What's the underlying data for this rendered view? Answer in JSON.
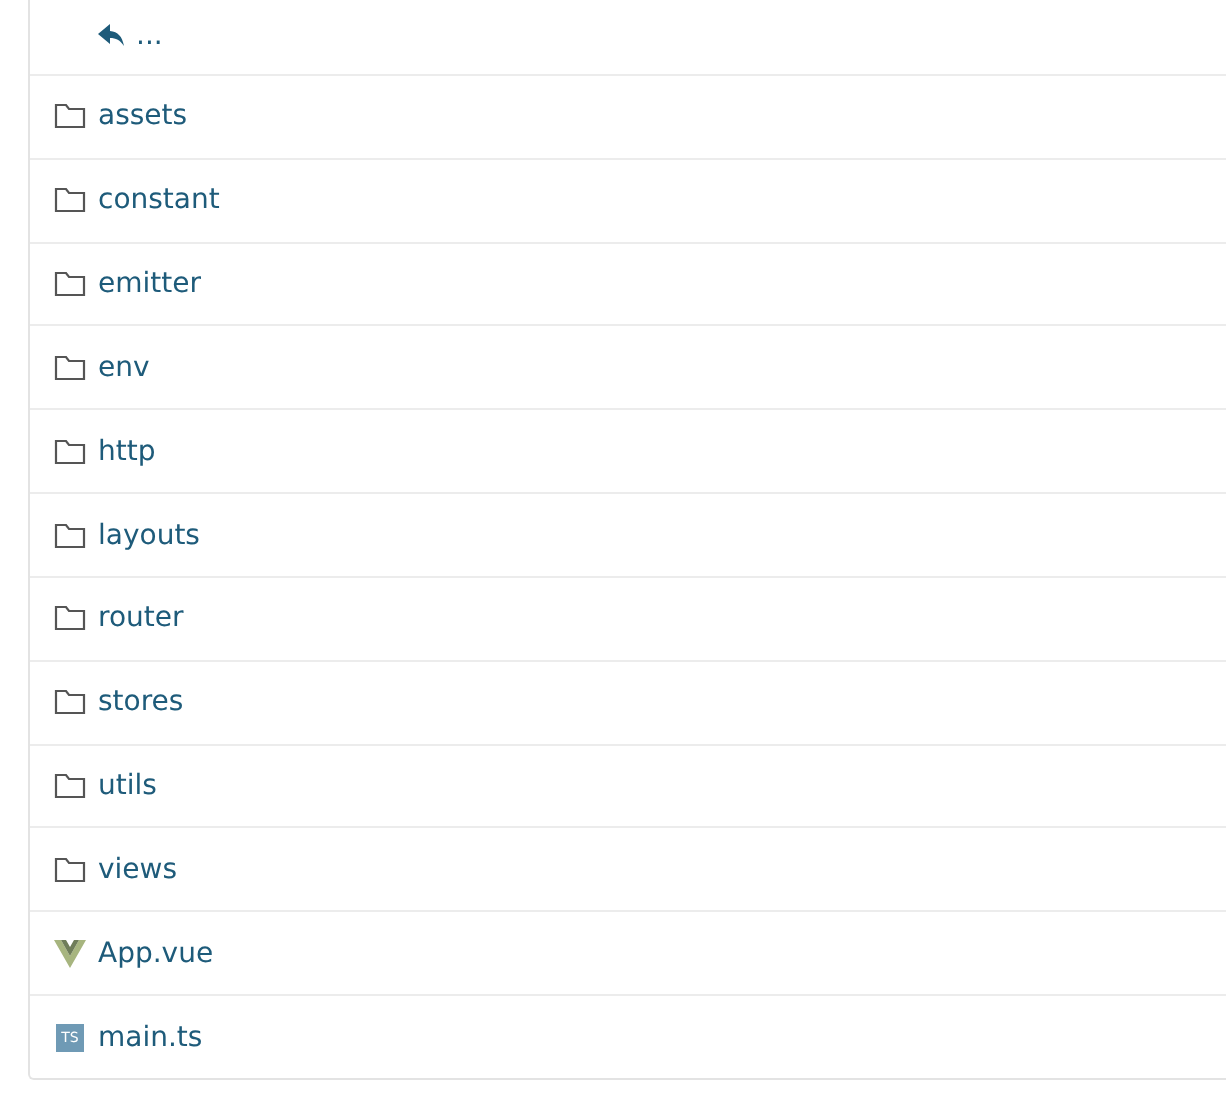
{
  "parent_link": {
    "label": "..."
  },
  "entries": [
    {
      "kind": "folder",
      "name": "assets"
    },
    {
      "kind": "folder",
      "name": "constant"
    },
    {
      "kind": "folder",
      "name": "emitter"
    },
    {
      "kind": "folder",
      "name": "env"
    },
    {
      "kind": "folder",
      "name": "http"
    },
    {
      "kind": "folder",
      "name": "layouts"
    },
    {
      "kind": "folder",
      "name": "router"
    },
    {
      "kind": "folder",
      "name": "stores"
    },
    {
      "kind": "folder",
      "name": "utils"
    },
    {
      "kind": "folder",
      "name": "views"
    },
    {
      "kind": "vue",
      "name": "App.vue"
    },
    {
      "kind": "ts",
      "name": "main.ts",
      "badge": "TS"
    }
  ]
}
